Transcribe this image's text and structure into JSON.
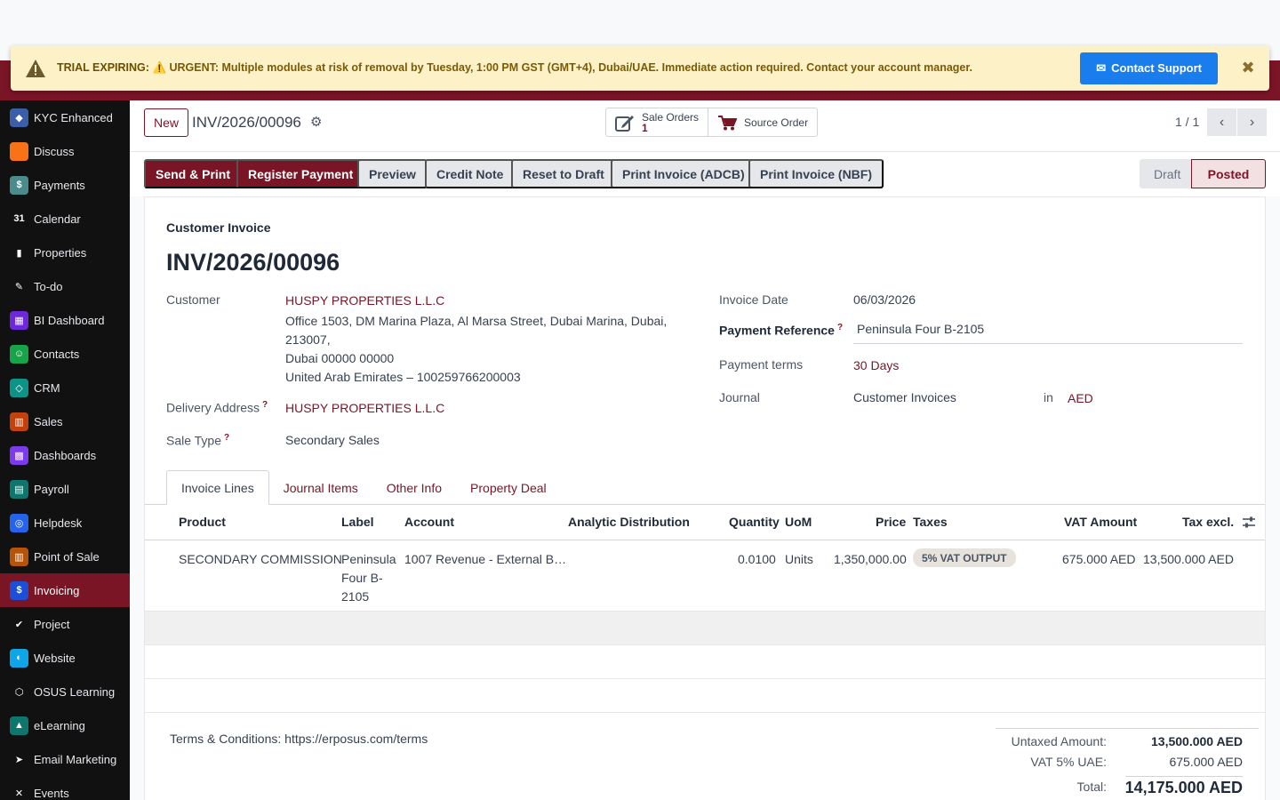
{
  "banner": {
    "label": "TRIAL EXPIRING:",
    "message": "⚠️ URGENT: Multiple modules at risk of removal by Tuesday, 1:00 PM GST (GMT+4), Dubai/UAE. Immediate action required. Contact your account manager.",
    "contact_label": "Contact Support",
    "close_glyph": "✖"
  },
  "sidebar": {
    "items": [
      {
        "label": "KYC Enhanced",
        "icon": "shield-icon",
        "color": "#3b5ea8",
        "glyph": "◆"
      },
      {
        "label": "Discuss",
        "icon": "chat-bubble-icon",
        "color": "#f97316",
        "glyph": ""
      },
      {
        "label": "Payments",
        "icon": "payments-icon",
        "color": "#4b8b8b",
        "glyph": "$"
      },
      {
        "label": "Calendar",
        "icon": "calendar-icon",
        "color": "#111111",
        "glyph": "31"
      },
      {
        "label": "Properties",
        "icon": "properties-icon",
        "color": "#111111",
        "glyph": "▮"
      },
      {
        "label": "To-do",
        "icon": "todo-icon",
        "color": "#111111",
        "glyph": "✎"
      },
      {
        "label": "BI Dashboard",
        "icon": "bi-dashboard-icon",
        "color": "#6d28d9",
        "glyph": "▦"
      },
      {
        "label": "Contacts",
        "icon": "contacts-icon",
        "color": "#16a34a",
        "glyph": "☺"
      },
      {
        "label": "CRM",
        "icon": "crm-icon",
        "color": "#0d9488",
        "glyph": "◇"
      },
      {
        "label": "Sales",
        "icon": "sales-icon",
        "color": "#c2410c",
        "glyph": "▥"
      },
      {
        "label": "Dashboards",
        "icon": "dashboards-icon",
        "color": "#7c3aed",
        "glyph": "▩"
      },
      {
        "label": "Payroll",
        "icon": "payroll-icon",
        "color": "#0f766e",
        "glyph": "▤"
      },
      {
        "label": "Helpdesk",
        "icon": "helpdesk-icon",
        "color": "#2563eb",
        "glyph": "◎"
      },
      {
        "label": "Point of Sale",
        "icon": "point-of-sale-icon",
        "color": "#b45309",
        "glyph": "▥"
      },
      {
        "label": "Invoicing",
        "icon": "invoicing-icon",
        "color": "#1d4ed8",
        "glyph": "$"
      },
      {
        "label": "Project",
        "icon": "project-icon",
        "color": "#111111",
        "glyph": "✔"
      },
      {
        "label": "Website",
        "icon": "website-icon",
        "color": "#0ea5e9",
        "glyph": "◐"
      },
      {
        "label": "OSUS Learning",
        "icon": "learning-cube-icon",
        "color": "#111111",
        "glyph": "⬡"
      },
      {
        "label": "eLearning",
        "icon": "elearning-icon",
        "color": "#0f766e",
        "glyph": "▲"
      },
      {
        "label": "Email Marketing",
        "icon": "email-marketing-icon",
        "color": "#111111",
        "glyph": "➤"
      },
      {
        "label": "Events",
        "icon": "events-icon",
        "color": "#111111",
        "glyph": "✕"
      }
    ],
    "active_index": 14
  },
  "control": {
    "new_label": "New",
    "record_title": "INV/2026/00096",
    "smart_buttons": [
      {
        "label": "Sale Orders",
        "count": "1"
      },
      {
        "label": "Source Order",
        "count": ""
      }
    ],
    "pager": "1 / 1"
  },
  "actions": {
    "buttons": [
      {
        "label": "Send & Print",
        "kind": "primary"
      },
      {
        "label": "Register Payment",
        "kind": "primary"
      },
      {
        "label": "Preview",
        "kind": "secondary"
      },
      {
        "label": "Credit Note",
        "kind": "secondary"
      },
      {
        "label": "Reset to Draft",
        "kind": "secondary"
      },
      {
        "label": "Print Invoice (ADCB)",
        "kind": "secondary"
      },
      {
        "label": "Print Invoice (NBF)",
        "kind": "secondary"
      }
    ],
    "status_draft": "Draft",
    "status_posted": "Posted"
  },
  "form": {
    "doc_type": "Customer Invoice",
    "doc_name": "INV/2026/00096",
    "customer_label": "Customer",
    "customer_value": "HUSPY PROPERTIES L.L.C",
    "address_lines": [
      "Office 1503, DM Marina Plaza, Al Marsa Street, Dubai Marina, Dubai, 213007,",
      "Dubai 00000 00000",
      "United Arab Emirates – 100259766200003"
    ],
    "delivery_label": "Delivery Address",
    "delivery_value": "HUSPY PROPERTIES L.L.C",
    "sale_type_label": "Sale Type",
    "sale_type_value": "Secondary Sales",
    "invoice_date_label": "Invoice Date",
    "invoice_date_value": "06/03/2026",
    "payment_ref_label": "Payment Reference",
    "payment_ref_value": "Peninsula Four B-2105",
    "payment_terms_label": "Payment terms",
    "payment_terms_value": "30 Days",
    "journal_label": "Journal",
    "journal_value": "Customer Invoices",
    "journal_in": "in",
    "journal_currency": "AED",
    "help_mark": "?"
  },
  "tabs": [
    "Invoice Lines",
    "Journal Items",
    "Other Info",
    "Property Deal"
  ],
  "table": {
    "columns": [
      "Product",
      "Label",
      "Account",
      "Analytic Distribution",
      "Quantity",
      "UoM",
      "Price",
      "Taxes",
      "VAT Amount",
      "Tax excl."
    ],
    "rows": [
      {
        "product": "SECONDARY COMMISSION",
        "label": "Peninsula Four B-2105",
        "account": "1007 Revenue - External B…",
        "analytic": "",
        "quantity": "0.0100",
        "uom": "Units",
        "price": "1,350,000.00",
        "taxes": "5% VAT OUTPUT",
        "vat_amount": "675.000 AED",
        "tax_excl": "13,500.000 AED"
      }
    ]
  },
  "footer": {
    "terms": "Terms & Conditions: https://erposus.com/terms",
    "untaxed_label": "Untaxed Amount:",
    "untaxed_value": "13,500.000 AED",
    "vat_label": "VAT 5% UAE:",
    "vat_value": "675.000 AED",
    "total_label": "Total:",
    "total_value": "14,175.000 AED"
  }
}
